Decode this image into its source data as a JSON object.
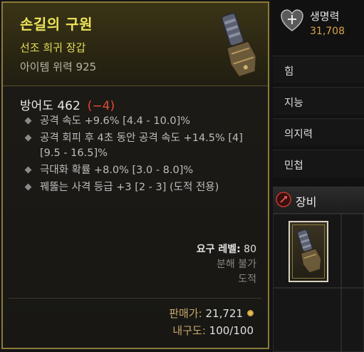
{
  "tooltip": {
    "item_name": "손길의 구원",
    "item_type": "선조 희귀 장갑",
    "item_power": "아이템 위력 925",
    "armor_label": "방어도 462",
    "armor_delta": "(−4)",
    "affixes": [
      "공격 속도 +9.6% [4.4 - 10.0]%",
      "공격 회피 후 4초 동안 공격 속도 +14.5% [4][9.5 - 16.5]%",
      "극대화 확률 +8.0% [3.0 - 8.0]%",
      "꿰뚫는 사격 등급 +3 [2 - 3] (도적 전용)"
    ],
    "required_level_label": "요구 레벨:",
    "required_level_value": "80",
    "salvage": "분해 불가",
    "class": "도적",
    "sell_label": "판매가:",
    "sell_value": "21,721",
    "durability_label": "내구도:",
    "durability_value": "100/100",
    "icon": "gauntlet-icon",
    "accent_color": "#ece45a",
    "border_color": "#8a7a3a"
  },
  "side": {
    "life_label": "생명력",
    "life_value": "31,708",
    "life_icon": "heart-shield-icon",
    "stats": [
      "힘",
      "지능",
      "의지력",
      "민첩"
    ],
    "equipment_label": "장비",
    "equipment_icon": "equipment-icon"
  }
}
